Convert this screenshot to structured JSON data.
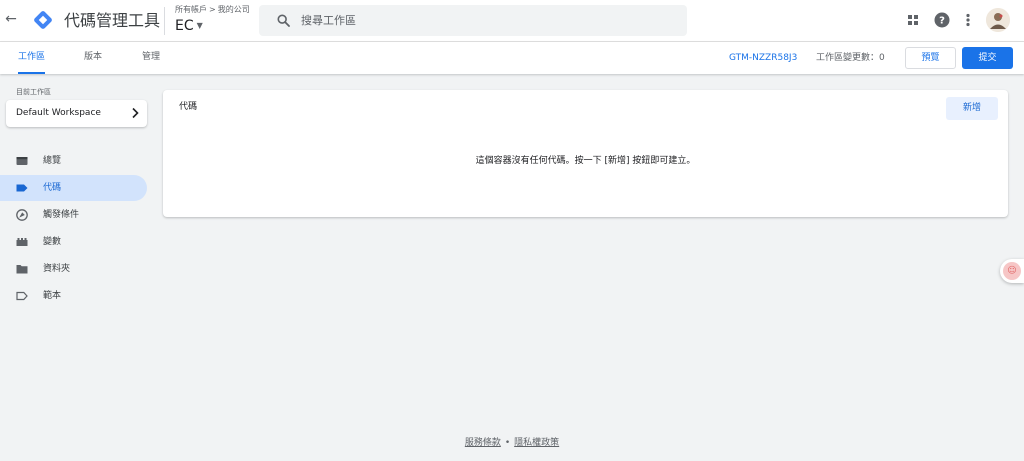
{
  "header": {
    "back_icon": "arrow-left-icon",
    "logo_icon": "tag-manager-logo",
    "product_name": "代碼管理工具",
    "breadcrumb": {
      "accounts": "所有帳戶",
      "separator": ">",
      "account": "我的公司"
    },
    "container": "EC",
    "search": {
      "placeholder": "搜尋工作區",
      "value": ""
    },
    "icons": [
      "apps-grid-icon",
      "help-icon",
      "more-vert-icon",
      "avatar"
    ]
  },
  "tabs": [
    {
      "label": "工作區",
      "active": true
    },
    {
      "label": "版本",
      "active": false
    },
    {
      "label": "管理",
      "active": false
    }
  ],
  "toolbar": {
    "container_id": "GTM-NZZR58J3",
    "changes_label": "工作區變更數：",
    "changes_count": "0",
    "preview_label": "預覽",
    "submit_label": "提交"
  },
  "sidebar": {
    "workspace_label": "目前工作區",
    "workspace_name": "Default Workspace",
    "items": [
      {
        "label": "總覽",
        "icon": "overview-icon",
        "active": false
      },
      {
        "label": "代碼",
        "icon": "tag-icon",
        "active": true
      },
      {
        "label": "觸發條件",
        "icon": "trigger-icon",
        "active": false
      },
      {
        "label": "變數",
        "icon": "variable-icon",
        "active": false
      },
      {
        "label": "資料夾",
        "icon": "folder-icon",
        "active": false
      },
      {
        "label": "範本",
        "icon": "template-icon",
        "active": false
      }
    ]
  },
  "main": {
    "card_title": "代碼",
    "new_label": "新增",
    "empty_message": "這個容器沒有任何代碼。按一下 [新增] 按鈕即可建立。"
  },
  "footer": {
    "terms": "服務條款",
    "separator": "•",
    "privacy": "隱私權政策"
  },
  "colors": {
    "accent": "#1a73e8",
    "active_nav_bg": "#d2e3fc",
    "page_bg": "#f1f3f4",
    "new_button_bg": "#e8f0fe"
  }
}
